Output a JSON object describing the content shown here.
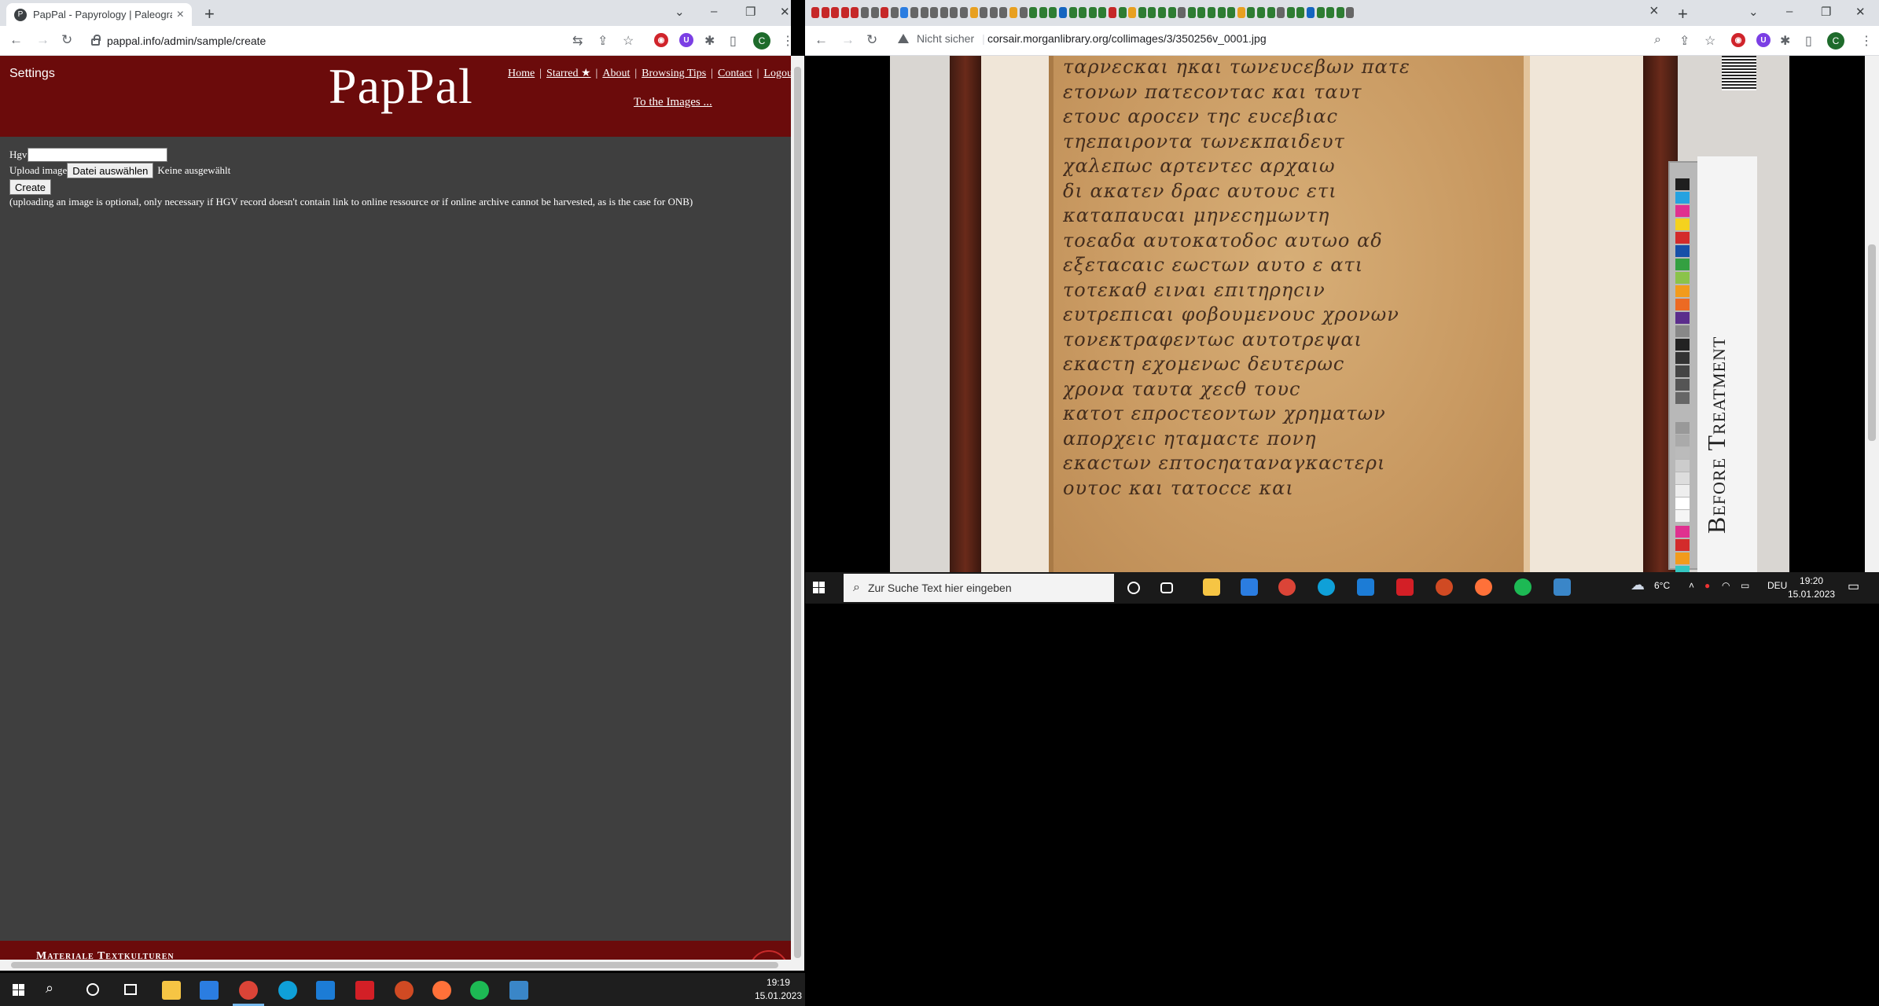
{
  "left_window": {
    "tab_title": "PapPal - Papyrology | Paleograph",
    "tab_favicon": "P",
    "url": "pappal.info/admin/sample/create"
  },
  "page": {
    "settings": "Settings",
    "logo": "PapPal",
    "nav": [
      "Home",
      "Starred ★",
      "About",
      "Browsing Tips",
      "Contact",
      "Logou"
    ],
    "to_images": "To the Images ...",
    "hgv_label": "Hgv",
    "upload_label": "Upload image",
    "file_button": "Datei auswählen",
    "file_status": "Keine ausgewählt",
    "create_button": "Create",
    "note": "(uploading an image is optional, only necessary if HGV record doesn't contain link to online ressource or if online archive cannot be harvested, as is the case for ONB)",
    "footer": "Materiale Textkulturen"
  },
  "right_window": {
    "security": "Nicht sicher",
    "url": "corsair.morganlibrary.org/collimages/3/350256v_0001.jpg",
    "image_caption": "Before Treatment",
    "papyrus_lines": [
      "ταρνεϲκαι ηκαι τωνευϲεβων πατε",
      "ετονων πατεϲονταϲ και ταυτ",
      "ετουϲ αροϲεν τηϲ ευϲεβιαϲ",
      "τηεπαιροντα τωνεκπαιδευτ",
      "χαλεπωϲ αρτεντεϲ αρχαιω",
      "δι ακατεν δραϲ αυτουϲ ετι",
      "καταπαυϲαι μηνεϲημωντη",
      "τοεαδα αυτοκατοδοϲ αυτωο αδ",
      "εξεταϲαιϲ εωϲτων αυτο ε ατι",
      "τοτεκαθ ειναι επιτηρηϲιν",
      "ευτρεπιϲαι φοβουμενουϲ χρονων",
      "τονεκτραφεντωϲ αυτοτρεψαι",
      "εκαϲτη εχομενωϲ δευτερωϲ",
      "χρονα ταυτα χεϲθ τουϲ",
      "κατοτ επροϲτεοντων χρηματων",
      "απορχειϲ ηταμαϲτε πονη",
      "εκαϲτων επτοϲηαταναγκαϲτερι",
      "ουτοϲ και τατοϲϲε και"
    ],
    "taskbar_search": "Zur Suche Text hier eingeben",
    "weather": "6°C",
    "lang": "DEU",
    "time": "19:20",
    "date": "15.01.2023"
  },
  "taskbar": {
    "time": "19:19",
    "date": "15.01.2023"
  },
  "colors": {
    "header_red": "#6b0b0b",
    "page_bg": "#3f3f3f",
    "papyrus": "#c99a62"
  }
}
